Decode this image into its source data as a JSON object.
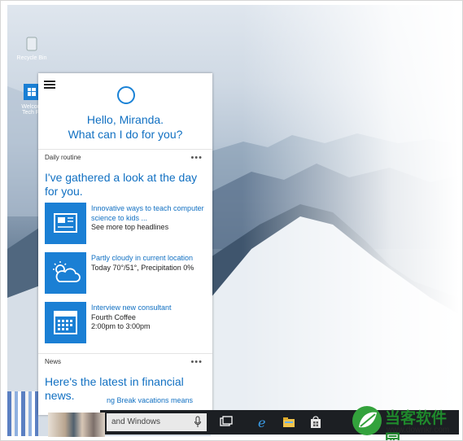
{
  "desktop": {
    "icons": [
      {
        "label": "Recycle Bin",
        "icon": "recycle-bin-icon"
      },
      {
        "label": "Welcom Tech Pr",
        "icon": "windows-logo-icon"
      }
    ]
  },
  "cortana": {
    "greeting_line1": "Hello, Miranda.",
    "greeting_line2": "What can I do for you?",
    "daily_routine": {
      "title": "Daily routine",
      "more": "•••",
      "headline": "I've gathered a look at the day for you.",
      "cards": [
        {
          "icon": "news-icon",
          "line1": "Innovative ways to teach computer science to kids ...",
          "line2": "See more top headlines",
          "line3": ""
        },
        {
          "icon": "partly-cloudy-icon",
          "line1": "Partly cloudy in current location",
          "line2": "Today 70°/51°, Precipitation 0%",
          "line3": ""
        },
        {
          "icon": "calendar-icon",
          "line1": "Interview new consultant",
          "line2": "Fourth Coffee",
          "line3": "2:00pm to 3:00pm"
        }
      ]
    },
    "news": {
      "title": "News",
      "more": "•••",
      "headline": "Here's the latest in financial news.",
      "item": "ng Break vacations means"
    }
  },
  "taskbar": {
    "search_placeholder": "and Windows",
    "buttons": [
      "task-view-icon",
      "edge-icon",
      "file-explorer-icon",
      "store-icon"
    ]
  },
  "watermark": {
    "brand": "当客软件园",
    "url": "www.downkr.com",
    "color": "#1f8a2c"
  },
  "colors": {
    "accent": "#1a7fd4",
    "link": "#1170c2"
  }
}
